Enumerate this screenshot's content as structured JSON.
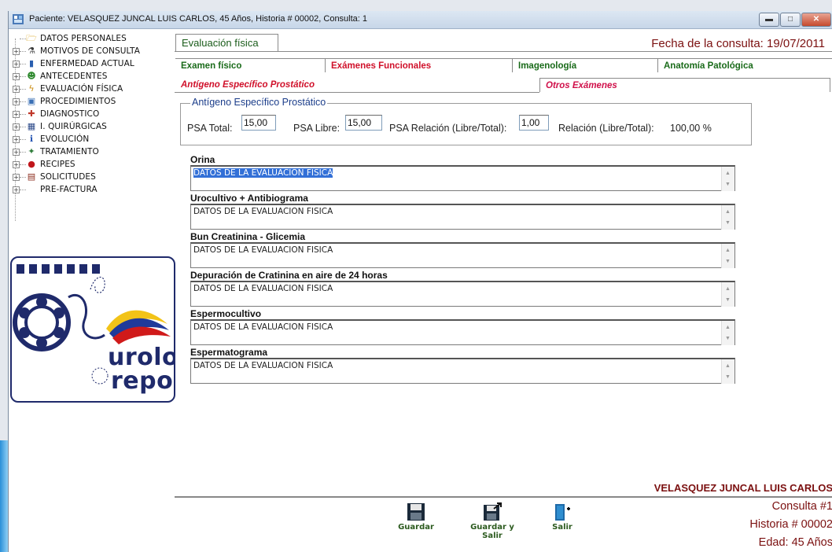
{
  "window": {
    "title": "Paciente: VELASQUEZ JUNCAL LUIS CARLOS, 45 Años, Historia # 00002, Consulta: 1",
    "minimize": "▬",
    "maximize": "□",
    "close": "✕"
  },
  "tree": [
    {
      "label": "DATOS PERSONALES",
      "icon": "folder-open-icon",
      "glyph": "🗁",
      "color": "#d9a520",
      "expander": ""
    },
    {
      "label": "MOTIVOS DE CONSULTA",
      "icon": "flask-icon",
      "glyph": "⚗",
      "color": "#3a3a3a",
      "expander": "+"
    },
    {
      "label": "ENFERMEDAD ACTUAL",
      "icon": "bar-chart-icon",
      "glyph": "▮",
      "color": "#2a5fb0",
      "expander": "+"
    },
    {
      "label": "ANTECEDENTES",
      "icon": "family-icon",
      "glyph": "☻",
      "color": "#2f8a2f",
      "expander": "+"
    },
    {
      "label": "EVALUACIÓN FÍSICA",
      "icon": "lightning-icon",
      "glyph": "ϟ",
      "color": "#c98b10",
      "expander": "+"
    },
    {
      "label": "PROCEDIMIENTOS",
      "icon": "monitor-icon",
      "glyph": "▣",
      "color": "#3a6fb5",
      "expander": "+"
    },
    {
      "label": "DIAGNOSTICO",
      "icon": "stethoscope-icon",
      "glyph": "✚",
      "color": "#c0392b",
      "expander": "+"
    },
    {
      "label": "I. QUIRÚRGICAS",
      "icon": "grid-icon",
      "glyph": "▦",
      "color": "#2d4a8a",
      "expander": "+"
    },
    {
      "label": "EVOLUCIÓN",
      "icon": "info-icon",
      "glyph": "ℹ",
      "color": "#1d4fb0",
      "expander": "+"
    },
    {
      "label": "TRATAMIENTO",
      "icon": "medicine-icon",
      "glyph": "✦",
      "color": "#2f7d3a",
      "expander": "+"
    },
    {
      "label": "RECIPES",
      "icon": "apple-icon",
      "glyph": "●",
      "color": "#c0161b",
      "expander": "+"
    },
    {
      "label": "SOLICITUDES",
      "icon": "document-stack-icon",
      "glyph": "▤",
      "color": "#8a2a1a",
      "expander": "+"
    },
    {
      "label": "PRE-FACTURA",
      "icon": "",
      "glyph": "",
      "color": "#333",
      "expander": "+"
    }
  ],
  "logo": {
    "line1": "urolo",
    "line2": "report"
  },
  "main": {
    "top_tab": "Evaluación física",
    "fecha_label": "Fecha de la consulta:",
    "fecha_value": "19/07/2011",
    "tabs": [
      {
        "label": "Examen físico",
        "color": "#1a6b1a"
      },
      {
        "label": "Exámenes Funcionales",
        "color": "#d0102a"
      },
      {
        "label": "Imagenología",
        "color": "#1a6b1a"
      },
      {
        "label": "Anatomía Patológica",
        "color": "#1a6b1a"
      }
    ],
    "subtabs": [
      {
        "label": "Antígeno Específico Prostático",
        "color": "#d0102a"
      },
      {
        "label": "Otros Exámenes",
        "color": "#d0104a"
      }
    ],
    "psa": {
      "group_title": "Antígeno Específico Prostático",
      "total_label": "PSA Total:",
      "total_value": "15,00",
      "libre_label": "PSA Libre:",
      "libre_value": "15,00",
      "relacion_label": "PSA Relación (Libre/Total):",
      "relacion_value": "1,00",
      "relacion_result_label": "Relación (Libre/Total):",
      "relacion_result_value": "100,00 %"
    },
    "sections": [
      {
        "label": "Orina",
        "text": "DATOS DE LA EVALUACION FISICA",
        "selected": true
      },
      {
        "label": "Urocultivo + Antibiograma",
        "text": "DATOS DE LA EVALUACION FISICA",
        "selected": false
      },
      {
        "label": "Bun Creatinina - Glicemia",
        "text": "DATOS DE LA EVALUACION FISICA",
        "selected": false
      },
      {
        "label": "Depuración de Cratinina en aire de 24 horas",
        "text": "DATOS DE LA EVALUACION FISICA",
        "selected": false
      },
      {
        "label": "Espermocultivo",
        "text": "DATOS DE LA EVALUACION FISICA",
        "selected": false
      },
      {
        "label": "Espermatograma",
        "text": "DATOS DE LA EVALUACION FISICA",
        "selected": false
      }
    ]
  },
  "patient": {
    "name": "VELASQUEZ JUNCAL LUIS CARLOS",
    "consulta": "Consulta #1",
    "historia": "Historia # 00002",
    "edad": "Edad: 45 Años"
  },
  "buttons": {
    "guardar": "Guardar",
    "guardar_salir": "Guardar y Salir",
    "salir": "Salir"
  }
}
